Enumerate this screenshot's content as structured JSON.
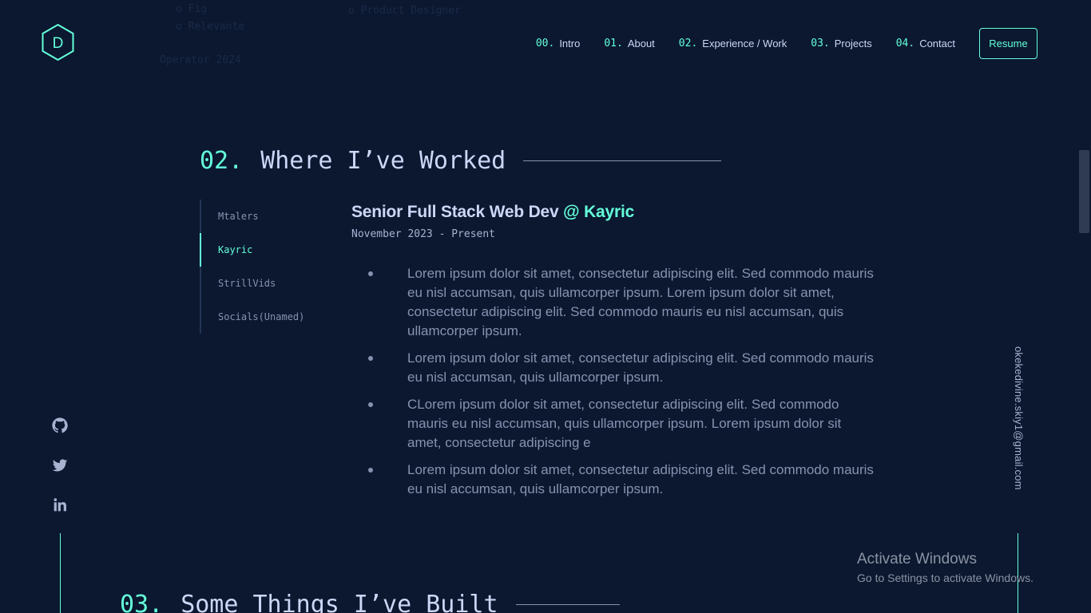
{
  "ghost": {
    "line1": "o  Fig",
    "line2": "o  Relevante",
    "line3": "Operator 2024",
    "line4": "o  Product Designer"
  },
  "logo": {
    "letter": "D"
  },
  "nav": {
    "items": [
      {
        "num": "00.",
        "label": "Intro"
      },
      {
        "num": "01.",
        "label": "About"
      },
      {
        "num": "02.",
        "label": "Experience / Work"
      },
      {
        "num": "03.",
        "label": "Projects"
      },
      {
        "num": "04.",
        "label": "Contact"
      }
    ],
    "resume": "Resume"
  },
  "experience": {
    "num": "02.",
    "title": "Where I’ve Worked",
    "tabs": [
      "Mtalers",
      "Kayric",
      "StrillVids",
      "Socials(Unamed)"
    ],
    "active_tab": "Kayric",
    "job": {
      "role": "Senior Full Stack Web Dev",
      "company": "@ Kayric",
      "range": "November 2023 - Present",
      "bullets": [
        "Lorem ipsum dolor sit amet, consectetur adipiscing elit. Sed commodo mauris eu nisl accumsan, quis ullamcorper ipsum. Lorem ipsum dolor sit amet, consectetur adipiscing elit. Sed commodo mauris eu nisl accumsan, quis ullamcorper ipsum.",
        "Lorem ipsum dolor sit amet, consectetur adipiscing elit. Sed commodo mauris eu nisl accumsan, quis ullamcorper ipsum.",
        "CLorem ipsum dolor sit amet, consectetur adipiscing elit. Sed commodo mauris eu nisl accumsan, quis ullamcorper ipsum. Lorem ipsum dolor sit amet, consectetur adipiscing e",
        "Lorem ipsum dolor sit amet, consectetur adipiscing elit. Sed commodo mauris eu nisl accumsan, quis ullamcorper ipsum."
      ]
    }
  },
  "projects": {
    "num": "03.",
    "title": "Some Things I’ve Built"
  },
  "social": {
    "icons": [
      "github-icon",
      "twitter-icon",
      "linkedin-icon"
    ]
  },
  "email": "okekedivine.skiy1@gmail.com",
  "watermark": {
    "title": "Activate Windows",
    "subtitle": "Go to Settings to activate Windows."
  },
  "colors": {
    "background": "#0b1830",
    "accent": "#64ffda",
    "text": "#ccd6f6",
    "muted": "#8892b0"
  }
}
